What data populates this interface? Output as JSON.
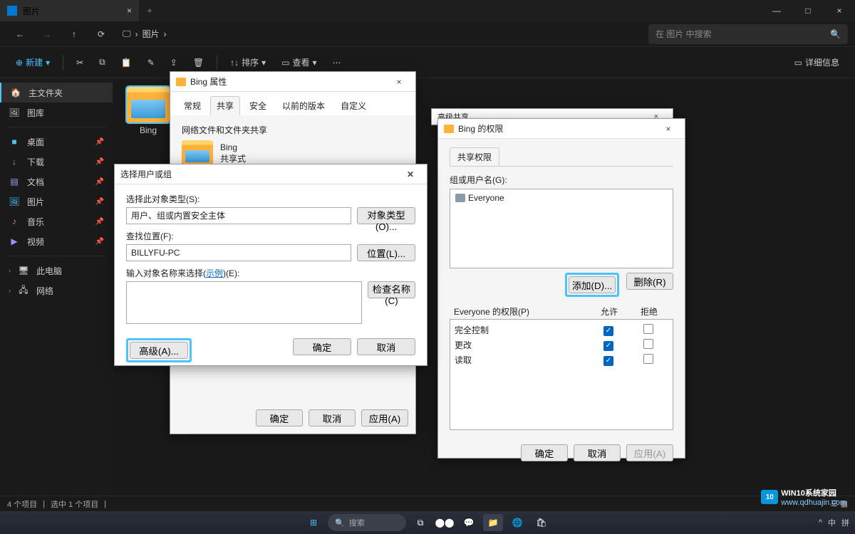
{
  "titlebar": {
    "tab_title": "图片",
    "tab_close": "×",
    "add": "+",
    "min": "—",
    "max": "□",
    "close": "×"
  },
  "nav": {
    "path_root": "图片",
    "chevron": "›",
    "search_placeholder": "在 图片 中搜索"
  },
  "toolbar": {
    "new": "新建",
    "sort": "排序",
    "view": "查看",
    "details": "详细信息",
    "icons": {
      "cut": "✂",
      "copy": "⧉",
      "paste": "📋",
      "rename": "✎",
      "share": "⇪",
      "delete": "🗑",
      "more": "⋯"
    }
  },
  "sidebar": {
    "home": "主文件夹",
    "gallery": "图库",
    "desktop": "桌面",
    "downloads": "下载",
    "documents": "文档",
    "pictures": "图片",
    "music": "音乐",
    "videos": "视频",
    "thispc": "此电脑",
    "network": "网络"
  },
  "content": {
    "folder_name": "Bing"
  },
  "status": {
    "items": "4 个项目",
    "selected": "选中 1 个项目"
  },
  "props_dialog": {
    "title": "Bing 属性",
    "tabs": {
      "general": "常规",
      "sharing": "共享",
      "security": "安全",
      "prev": "以前的版本",
      "custom": "自定义"
    },
    "section_label": "网络文件和文件夹共享",
    "folder_name": "Bing",
    "share_status": "共享式",
    "ok": "确定",
    "cancel": "取消",
    "apply": "应用(A)"
  },
  "select_users_dialog": {
    "title": "选择用户或组",
    "object_type_label": "选择此对象类型(S):",
    "object_type_value": "用户、组或内置安全主体",
    "object_type_btn": "对象类型(O)...",
    "location_label": "查找位置(F):",
    "location_value": "BILLYFU-PC",
    "location_btn": "位置(L)...",
    "names_label_pre": "输入对象名称来选择(",
    "names_label_link": "示例",
    "names_label_post": ")(E):",
    "check_names_btn": "检查名称(C)",
    "advanced_btn": "高级(A)...",
    "ok": "确定",
    "cancel": "取消"
  },
  "adv_share_dialog": {
    "title": "高级共享"
  },
  "perms_dialog": {
    "title": "Bing 的权限",
    "tab": "共享权限",
    "group_label": "组或用户名(G):",
    "everyone": "Everyone",
    "add_btn": "添加(D)...",
    "remove_btn": "删除(R)",
    "perm_header": "Everyone 的权限(P)",
    "allow": "允许",
    "deny": "拒绝",
    "perms": [
      {
        "name": "完全控制",
        "allow": true,
        "deny": false
      },
      {
        "name": "更改",
        "allow": true,
        "deny": false
      },
      {
        "name": "读取",
        "allow": true,
        "deny": false
      }
    ],
    "ok": "确定",
    "cancel": "取消",
    "apply": "应用(A)"
  },
  "taskbar": {
    "search": "搜索",
    "ime": "中",
    "more": "拼"
  },
  "watermark": {
    "text1": "WIN10系统家园",
    "text2": "www.qdhuajin.com"
  }
}
